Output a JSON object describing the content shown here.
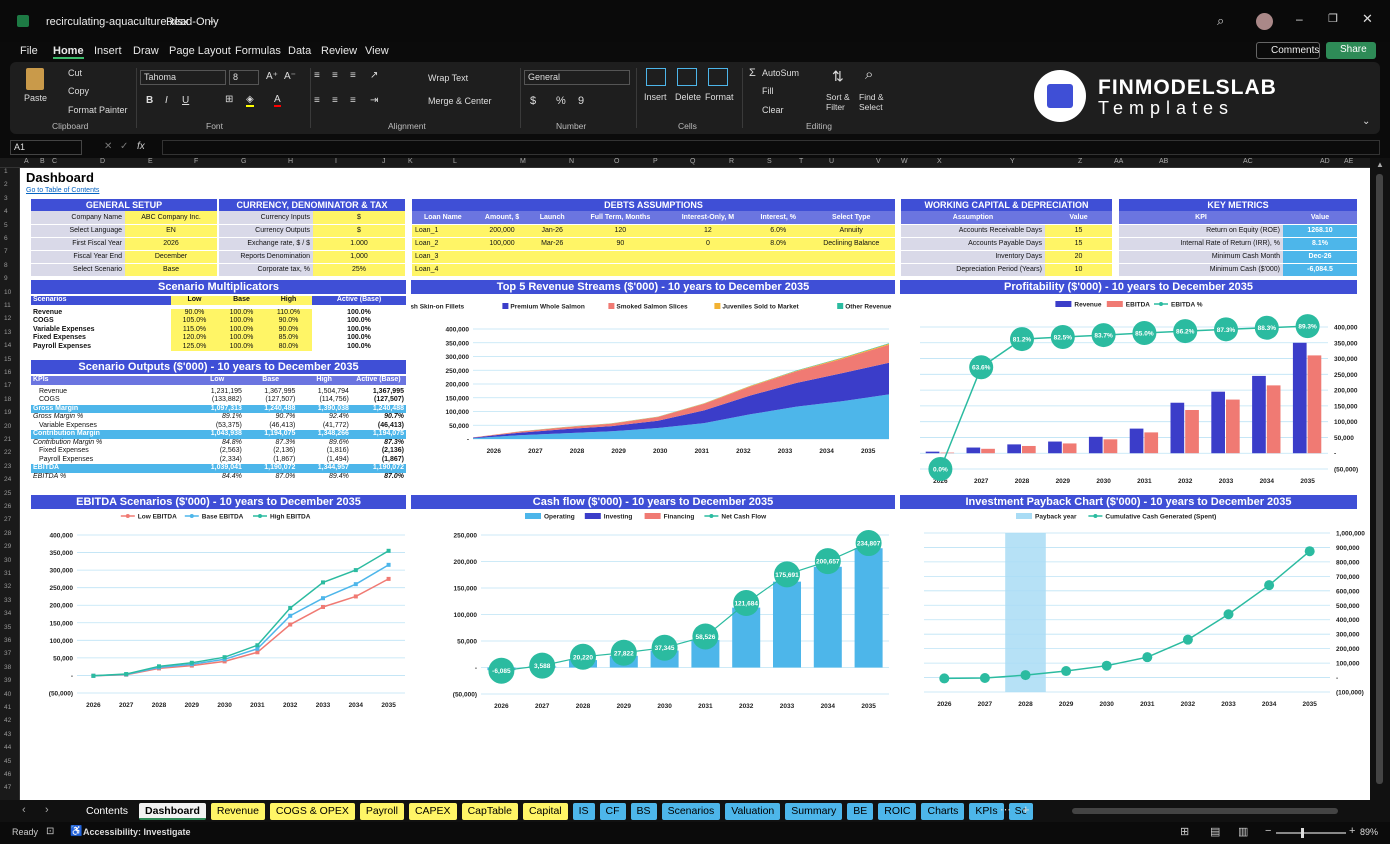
{
  "window": {
    "title": "recirculating-aquaculture.xlsx",
    "mode": "Read-Only"
  },
  "menu": [
    "File",
    "Home",
    "Insert",
    "Draw",
    "Page Layout",
    "Formulas",
    "Data",
    "Review",
    "View"
  ],
  "top_buttons": {
    "comments": "Comments",
    "share": "Share"
  },
  "ribbon": {
    "paste": "Paste",
    "cut": "Cut",
    "copy": "Copy",
    "format_painter": "Format Painter",
    "clipboard": "Clipboard",
    "font_name": "Tahoma",
    "font_size": "8",
    "font": "Font",
    "wrap_text": "Wrap Text",
    "merge_center": "Merge & Center",
    "alignment": "Alignment",
    "number_format": "General",
    "number": "Number",
    "insert": "Insert",
    "delete": "Delete",
    "format": "Format",
    "cells": "Cells",
    "autosum": "AutoSum",
    "fill": "Fill",
    "clear": "Clear",
    "sort_filter": "Sort & Filter",
    "find_select": "Find & Select",
    "editing": "Editing",
    "logo_line1": "FINMODELSLAB",
    "logo_line2": "Templates"
  },
  "formula_bar": {
    "cell_ref": "A1",
    "fx": "fx"
  },
  "columns": [
    "A",
    "B",
    "C",
    "D",
    "E",
    "F",
    "G",
    "H",
    "I",
    "J",
    "K",
    "L",
    "M",
    "N",
    "O",
    "P",
    "Q",
    "R",
    "S",
    "T",
    "U",
    "V",
    "W",
    "X",
    "Y",
    "Z",
    "AA",
    "AB",
    "AC",
    "AD",
    "AE"
  ],
  "sheet": {
    "title": "Dashboard",
    "link": "Go to Table of Contents"
  },
  "general_setup": {
    "header": "GENERAL SETUP",
    "rows": [
      [
        "Company Name",
        "ABC Company Inc."
      ],
      [
        "Select Language",
        "EN"
      ],
      [
        "First Fiscal Year",
        "2026"
      ],
      [
        "Fiscal Year End",
        "December"
      ],
      [
        "Select Scenario",
        "Base"
      ]
    ]
  },
  "currency": {
    "header": "CURRENCY, DENOMINATOR & TAX",
    "rows": [
      [
        "Currency Inputs",
        "$"
      ],
      [
        "Currency Outputs",
        "$"
      ],
      [
        "Exchange rate, $ / $",
        "1.000"
      ],
      [
        "Reports Denomination",
        "1,000"
      ],
      [
        "Corporate tax, %",
        "25%"
      ]
    ]
  },
  "debts": {
    "header": "DEBTS ASSUMPTIONS",
    "cols": [
      "Loan Name",
      "Amount, $",
      "Launch",
      "Full Term, Months",
      "Interest-Only, M",
      "Interest, %",
      "Select Type"
    ],
    "rows": [
      [
        "Loan_1",
        "200,000",
        "Jan-26",
        "120",
        "12",
        "6.0%",
        "Annuity"
      ],
      [
        "Loan_2",
        "100,000",
        "Mar-26",
        "90",
        "0",
        "8.0%",
        "Declining Balance"
      ],
      [
        "Loan_3",
        "",
        "",
        "",
        "",
        "",
        ""
      ],
      [
        "Loan_4",
        "",
        "",
        "",
        "",
        "",
        ""
      ]
    ]
  },
  "working_capital": {
    "header": "WORKING CAPITAL & DEPRECIATION",
    "cols": [
      "Assumption",
      "Value"
    ],
    "rows": [
      [
        "Accounts Receivable Days",
        "15"
      ],
      [
        "Accounts Payable Days",
        "15"
      ],
      [
        "Inventory Days",
        "20"
      ],
      [
        "Depreciation Period (Years)",
        "10"
      ]
    ]
  },
  "key_metrics": {
    "header": "KEY METRICS",
    "cols": [
      "KPI",
      "Value"
    ],
    "rows": [
      [
        "Return on Equity (ROE)",
        "1268.10"
      ],
      [
        "Internal Rate of Return (IRR), %",
        "8.1%"
      ],
      [
        "Minimum Cash Month",
        "Dec-26"
      ],
      [
        "Minimum Cash ($'000)",
        "-6,084.5"
      ]
    ]
  },
  "scenario_mult": {
    "title": "Scenario Multiplicators",
    "cols": [
      "Scenarios",
      "Low",
      "Base",
      "High",
      "Active (Base)"
    ],
    "rows": [
      [
        "Revenue",
        "90.0%",
        "100.0%",
        "110.0%",
        "100.0%"
      ],
      [
        "COGS",
        "105.0%",
        "100.0%",
        "90.0%",
        "100.0%"
      ],
      [
        "Variable Expenses",
        "115.0%",
        "100.0%",
        "90.0%",
        "100.0%"
      ],
      [
        "Fixed Expenses",
        "120.0%",
        "100.0%",
        "85.0%",
        "100.0%"
      ],
      [
        "Payroll Expenses",
        "125.0%",
        "100.0%",
        "80.0%",
        "100.0%"
      ]
    ]
  },
  "scenario_out": {
    "title": "Scenario Outputs ($'000) - 10 years to December 2035",
    "cols": [
      "KPIs",
      "Low",
      "Base",
      "High",
      "Active (Base)"
    ],
    "rows": [
      {
        "c": [
          "Revenue",
          "1,231,195",
          "1,367,995",
          "1,504,794",
          "1,367,995"
        ],
        "s": "i"
      },
      {
        "c": [
          "COGS",
          "(133,882)",
          "(127,507)",
          "(114,756)",
          "(127,507)"
        ],
        "s": "i"
      },
      {
        "c": [
          "Gross Margin",
          "1,097,313",
          "1,240,488",
          "1,390,038",
          "1,240,488"
        ],
        "s": "b"
      },
      {
        "c": [
          "Gross Margin %",
          "89.1%",
          "90.7%",
          "92.4%",
          "90.7%"
        ],
        "s": "p"
      },
      {
        "c": [
          "Variable Expenses",
          "(53,375)",
          "(46,413)",
          "(41,772)",
          "(46,413)"
        ],
        "s": "i"
      },
      {
        "c": [
          "Contribution Margin",
          "1,043,938",
          "1,194,075",
          "1,348,266",
          "1,194,075"
        ],
        "s": "b"
      },
      {
        "c": [
          "Contribution Margin %",
          "84.8%",
          "87.3%",
          "89.6%",
          "87.3%"
        ],
        "s": "p"
      },
      {
        "c": [
          "Fixed Expenses",
          "(2,563)",
          "(2,136)",
          "(1,816)",
          "(2,136)"
        ],
        "s": "i"
      },
      {
        "c": [
          "Payroll Expenses",
          "(2,334)",
          "(1,867)",
          "(1,494)",
          "(1,867)"
        ],
        "s": "i"
      },
      {
        "c": [
          "EBITDA",
          "1,039,041",
          "1,190,072",
          "1,344,957",
          "1,190,072"
        ],
        "s": "b"
      },
      {
        "c": [
          "EBITDA %",
          "84.4%",
          "87.0%",
          "89.4%",
          "87.0%"
        ],
        "s": "p"
      }
    ]
  },
  "revenue_chart": {
    "title": "Top 5 Revenue Streams ($'000) - 10 years to December 2035",
    "type": "area",
    "categories": [
      "2026",
      "2027",
      "2028",
      "2029",
      "2030",
      "2031",
      "2032",
      "2033",
      "2034",
      "2035"
    ],
    "yticks": [
      "400,000",
      "350,000",
      "300,000",
      "250,000",
      "200,000",
      "150,000",
      "100,000",
      "50,000",
      "-"
    ],
    "ylim": [
      0,
      400000
    ],
    "series": [
      {
        "name": "Fresh Skin-on Fillets",
        "color": "#4db6ea",
        "values": [
          3000,
          14000,
          21000,
          28000,
          40000,
          58000,
          90000,
          118000,
          138000,
          162000
        ]
      },
      {
        "name": "Premium Whole Salmon",
        "color": "#3b3dc9",
        "values": [
          2000,
          9000,
          15000,
          19000,
          26000,
          46000,
          68000,
          86000,
          102000,
          115000
        ]
      },
      {
        "name": "Smoked Salmon Slices",
        "color": "#f07a73",
        "values": [
          800,
          4000,
          7000,
          9000,
          14000,
          24000,
          33000,
          42000,
          52000,
          66000
        ]
      },
      {
        "name": "Juveniles Sold to Market",
        "color": "#f2b233",
        "values": [
          100,
          400,
          600,
          800,
          1000,
          1500,
          2000,
          2500,
          3000,
          3500
        ]
      },
      {
        "name": "Other Revenue",
        "color": "#2bbba0",
        "values": [
          50,
          200,
          300,
          400,
          500,
          600,
          800,
          1000,
          1200,
          1500
        ]
      }
    ]
  },
  "profit_chart": {
    "title": "Profitability ($'000) - 10 years to December 2035",
    "type": "bar",
    "categories": [
      "2026",
      "2027",
      "2028",
      "2029",
      "2030",
      "2031",
      "2032",
      "2033",
      "2034",
      "2035"
    ],
    "yticks": [
      "400,000",
      "350,000",
      "300,000",
      "250,000",
      "200,000",
      "150,000",
      "100,000",
      "50,000",
      "-",
      "(50,000)"
    ],
    "ylim": [
      -50000,
      400000
    ],
    "series": [
      {
        "name": "Revenue",
        "color": "#3b3dc9",
        "values": [
          5000,
          18000,
          28000,
          37000,
          52000,
          78000,
          160000,
          195000,
          245000,
          350000
        ]
      },
      {
        "name": "EBITDA",
        "color": "#f07a73",
        "values": [
          2000,
          14000,
          23000,
          31000,
          44000,
          66000,
          137000,
          170000,
          215000,
          310000
        ]
      },
      {
        "name": "EBITDA %",
        "color": "#2bbba0",
        "labels": [
          "0.0%",
          "63.6%",
          "81.2%",
          "82.5%",
          "83.7%",
          "85.0%",
          "86.2%",
          "87.3%",
          "88.3%",
          "89.3%"
        ],
        "values": [
          0,
          63.6,
          81.2,
          82.5,
          83.7,
          85.0,
          86.2,
          87.3,
          88.3,
          89.3
        ]
      }
    ]
  },
  "ebitda_chart": {
    "title": "EBITDA Scenarios ($'000) - 10 years to December 2035",
    "type": "line",
    "categories": [
      "2026",
      "2027",
      "2028",
      "2029",
      "2030",
      "2031",
      "2032",
      "2033",
      "2034",
      "2035"
    ],
    "yticks": [
      "400,000",
      "350,000",
      "300,000",
      "250,000",
      "200,000",
      "150,000",
      "100,000",
      "50,000",
      "-",
      "(50,000)"
    ],
    "ylim": [
      -50000,
      400000
    ],
    "series": [
      {
        "name": "Low EBITDA",
        "color": "#f07a73",
        "values": [
          -1000,
          2000,
          20000,
          28000,
          40000,
          66000,
          145000,
          195000,
          225000,
          275000
        ]
      },
      {
        "name": "Base EBITDA",
        "color": "#4db6ea",
        "values": [
          -1000,
          3000,
          23000,
          32000,
          46000,
          76000,
          170000,
          220000,
          260000,
          315000
        ]
      },
      {
        "name": "High EBITDA",
        "color": "#2bbba0",
        "values": [
          -1000,
          4000,
          26000,
          36000,
          52000,
          86000,
          192000,
          265000,
          300000,
          355000
        ]
      }
    ]
  },
  "cash_chart": {
    "title": "Cash flow ($'000) - 10 years to December 2035",
    "type": "bar",
    "categories": [
      "2026",
      "2027",
      "2028",
      "2029",
      "2030",
      "2031",
      "2032",
      "2033",
      "2034",
      "2035"
    ],
    "yticks": [
      "250,000",
      "200,000",
      "150,000",
      "100,000",
      "50,000",
      "-",
      "(50,000)"
    ],
    "ylim": [
      -50000,
      250000
    ],
    "series": [
      {
        "name": "Operating",
        "color": "#4db6ea",
        "values": [
          -5000,
          2000,
          14000,
          22000,
          32000,
          52000,
          113000,
          162000,
          190000,
          225000
        ]
      },
      {
        "name": "Investing",
        "color": "#3b3dc9",
        "values": []
      },
      {
        "name": "Financing",
        "color": "#f07a73",
        "values": []
      },
      {
        "name": "Net Cash Flow",
        "color": "#2bbba0",
        "labels": [
          "-6,085",
          "3,588",
          "20,220",
          "27,822",
          "37,345",
          "58,526",
          "121,684",
          "175,691",
          "200,657",
          "234,807"
        ],
        "values": [
          -6085,
          3588,
          20220,
          27822,
          37345,
          58526,
          121684,
          175691,
          200657,
          234807
        ]
      }
    ]
  },
  "payback_chart": {
    "title": "Investment Payback Chart ($'000) - 10 years to December 2035",
    "type": "line",
    "categories": [
      "2026",
      "2027",
      "2028",
      "2029",
      "2030",
      "2031",
      "2032",
      "2033",
      "2034",
      "2035"
    ],
    "yticks": [
      "1,000,000",
      "900,000",
      "800,000",
      "700,000",
      "600,000",
      "500,000",
      "400,000",
      "300,000",
      "200,000",
      "100,000",
      "-",
      "(100,000)"
    ],
    "ylim": [
      -100000,
      1000000
    ],
    "payback_year": "2028",
    "series": [
      {
        "name": "Payback year",
        "color": "#a9dcf5",
        "values": []
      },
      {
        "name": "Cumulative Cash Generated (Spent)",
        "color": "#2bbba0",
        "values": [
          -6000,
          -3000,
          17000,
          45000,
          82000,
          141000,
          262000,
          438000,
          639000,
          874000
        ]
      }
    ]
  },
  "sheet_tabs": [
    {
      "n": "Contents",
      "c": "#111",
      "t": "#fff"
    },
    {
      "n": "Dashboard",
      "c": "#f2f2f2",
      "t": "#000"
    },
    {
      "n": "Revenue",
      "c": "#fff566",
      "t": "#000"
    },
    {
      "n": "COGS & OPEX",
      "c": "#fff566",
      "t": "#000"
    },
    {
      "n": "Payroll",
      "c": "#fff566",
      "t": "#000"
    },
    {
      "n": "CAPEX",
      "c": "#fff566",
      "t": "#000"
    },
    {
      "n": "CapTable",
      "c": "#fff566",
      "t": "#000"
    },
    {
      "n": "Capital",
      "c": "#fff566",
      "t": "#000"
    },
    {
      "n": "IS",
      "c": "#4db6ea",
      "t": "#000"
    },
    {
      "n": "CF",
      "c": "#4db6ea",
      "t": "#000"
    },
    {
      "n": "BS",
      "c": "#4db6ea",
      "t": "#000"
    },
    {
      "n": "Scenarios",
      "c": "#4db6ea",
      "t": "#000"
    },
    {
      "n": "Valuation",
      "c": "#4db6ea",
      "t": "#000"
    },
    {
      "n": "Summary",
      "c": "#4db6ea",
      "t": "#000"
    },
    {
      "n": "BE",
      "c": "#4db6ea",
      "t": "#000"
    },
    {
      "n": "ROIC",
      "c": "#4db6ea",
      "t": "#000"
    },
    {
      "n": "Charts",
      "c": "#4db6ea",
      "t": "#000"
    },
    {
      "n": "KPIs",
      "c": "#4db6ea",
      "t": "#000"
    },
    {
      "n": "Sc",
      "c": "#4db6ea",
      "t": "#000"
    }
  ],
  "status": {
    "ready": "Ready",
    "accessibility": "Accessibility: Investigate",
    "zoom": "89%"
  }
}
